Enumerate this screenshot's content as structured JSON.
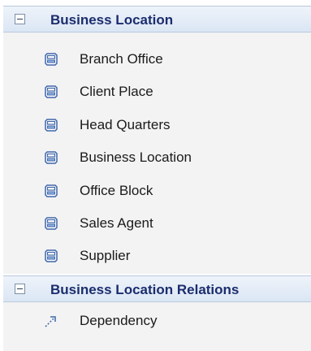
{
  "groups": [
    {
      "label": "Business Location",
      "toggle_icon": "collapse-minus-icon",
      "items": [
        {
          "label": "Branch Office",
          "icon": "location-element-icon"
        },
        {
          "label": "Client Place",
          "icon": "location-element-icon"
        },
        {
          "label": "Head Quarters",
          "icon": "location-element-icon"
        },
        {
          "label": "Business Location",
          "icon": "location-element-icon"
        },
        {
          "label": "Office Block",
          "icon": "location-element-icon"
        },
        {
          "label": "Sales Agent",
          "icon": "location-element-icon"
        },
        {
          "label": "Supplier",
          "icon": "location-element-icon"
        }
      ]
    },
    {
      "label": "Business Location Relations",
      "toggle_icon": "collapse-minus-icon",
      "items": [
        {
          "label": "Dependency",
          "icon": "dependency-arrow-icon"
        }
      ]
    }
  ],
  "colors": {
    "header_text": "#1b2d6e",
    "header_bg": "#dbe6f4",
    "body_bg": "#f3f3f4",
    "icon_blue": "#3f66a8"
  }
}
